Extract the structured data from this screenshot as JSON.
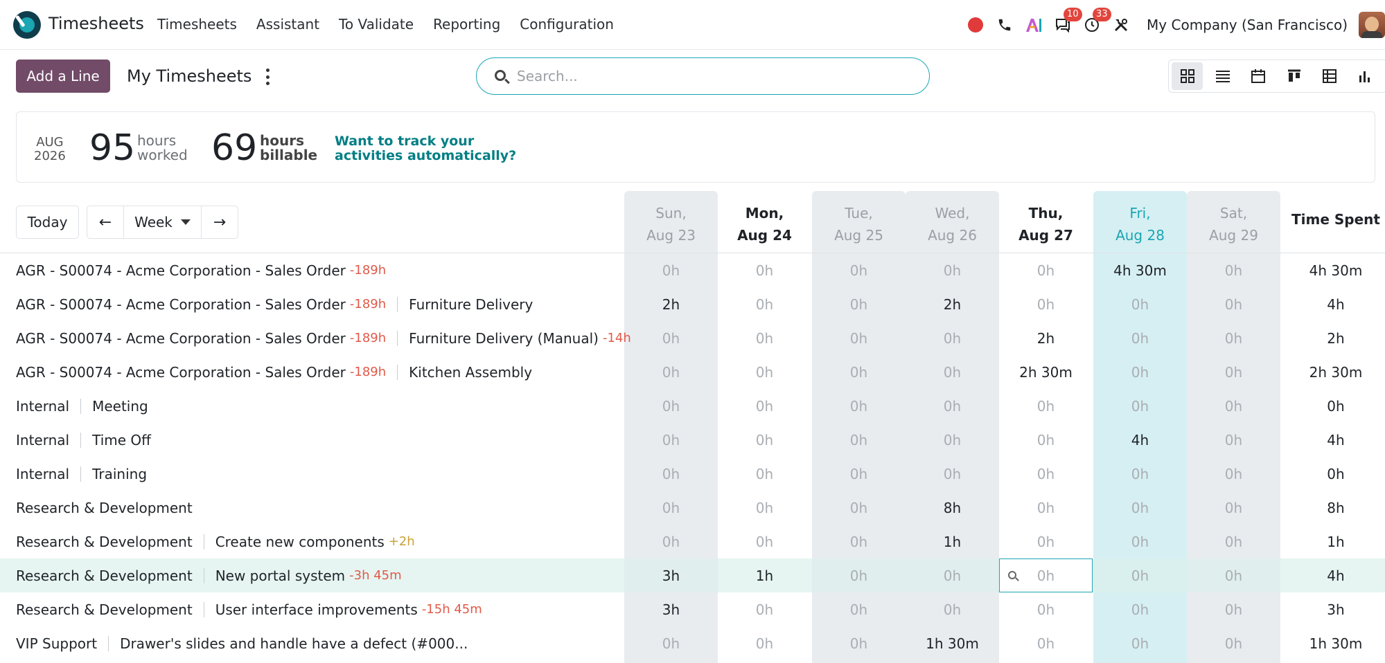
{
  "app": {
    "title": "Timesheets",
    "menu": [
      "Timesheets",
      "Assistant",
      "To Validate",
      "Reporting",
      "Configuration"
    ],
    "company": "My Company (San Francisco)",
    "badges": {
      "messages": "10",
      "activities": "33"
    },
    "icons": [
      "record-dot-icon",
      "phone-icon",
      "ai-icon",
      "chat-icon",
      "clock-icon",
      "tools-icon"
    ]
  },
  "control": {
    "add_label": "Add a Line",
    "page_title": "My Timesheets",
    "search_placeholder": "Search...",
    "views": [
      "grid-view-icon",
      "list-view-icon",
      "calendar-view-icon",
      "kanban-view-icon",
      "pivot-view-icon",
      "graph-view-icon"
    ],
    "active_view": "grid-view-icon"
  },
  "stats": {
    "month": "AUG",
    "year": "2026",
    "worked_value": "95",
    "worked_label_1": "hours",
    "worked_label_2": "worked",
    "billable_value": "69",
    "billable_label_1": "hours",
    "billable_label_2": "billable",
    "link_line_1": "Want to track your",
    "link_line_2": "activities automatically?"
  },
  "nav": {
    "today": "Today",
    "range": "Week",
    "prev": "←",
    "next": "→"
  },
  "colors": {
    "primary": "#714b67",
    "accent": "#1aa6b3",
    "negative": "#e05a4a",
    "positive": "#c9a23a"
  },
  "grid": {
    "days": [
      {
        "dow": "Sun,",
        "date": "Aug 23",
        "kind": "weekend"
      },
      {
        "dow": "Mon,",
        "date": "Aug 24",
        "kind": "normal"
      },
      {
        "dow": "Tue,",
        "date": "Aug 25",
        "kind": "weekend"
      },
      {
        "dow": "Wed,",
        "date": "Aug 26",
        "kind": "weekend"
      },
      {
        "dow": "Thu,",
        "date": "Aug 27",
        "kind": "normal"
      },
      {
        "dow": "Fri,",
        "date": "Aug 28",
        "kind": "today"
      },
      {
        "dow": "Sat,",
        "date": "Aug 29",
        "kind": "weekend"
      }
    ],
    "total_label": "Time Spent",
    "rows": [
      {
        "project": "AGR - S00074 - Acme Corporation - Sales Order",
        "project_delta": "-189h",
        "task": "",
        "task_delta": "",
        "task_delta_kind": "",
        "cells": [
          "0h",
          "0h",
          "0h",
          "0h",
          "0h",
          "4h 30m",
          "0h"
        ],
        "total": "4h 30m"
      },
      {
        "project": "AGR - S00074 - Acme Corporation - Sales Order",
        "project_delta": "-189h",
        "task": "Furniture Delivery",
        "task_delta": "",
        "task_delta_kind": "",
        "cells": [
          "2h",
          "0h",
          "0h",
          "2h",
          "0h",
          "0h",
          "0h"
        ],
        "total": "4h"
      },
      {
        "project": "AGR - S00074 - Acme Corporation - Sales Order",
        "project_delta": "-189h",
        "task": "Furniture Delivery (Manual)",
        "task_delta": "-14h",
        "task_delta_kind": "neg",
        "cells": [
          "0h",
          "0h",
          "0h",
          "0h",
          "2h",
          "0h",
          "0h"
        ],
        "total": "2h"
      },
      {
        "project": "AGR - S00074 - Acme Corporation - Sales Order",
        "project_delta": "-189h",
        "task": "Kitchen Assembly",
        "task_delta": "",
        "task_delta_kind": "",
        "cells": [
          "0h",
          "0h",
          "0h",
          "0h",
          "2h 30m",
          "0h",
          "0h"
        ],
        "total": "2h 30m"
      },
      {
        "project": "Internal",
        "project_delta": "",
        "task": "Meeting",
        "task_delta": "",
        "task_delta_kind": "",
        "cells": [
          "0h",
          "0h",
          "0h",
          "0h",
          "0h",
          "0h",
          "0h"
        ],
        "total": "0h"
      },
      {
        "project": "Internal",
        "project_delta": "",
        "task": "Time Off",
        "task_delta": "",
        "task_delta_kind": "",
        "cells": [
          "0h",
          "0h",
          "0h",
          "0h",
          "0h",
          "4h",
          "0h"
        ],
        "total": "4h"
      },
      {
        "project": "Internal",
        "project_delta": "",
        "task": "Training",
        "task_delta": "",
        "task_delta_kind": "",
        "cells": [
          "0h",
          "0h",
          "0h",
          "0h",
          "0h",
          "0h",
          "0h"
        ],
        "total": "0h"
      },
      {
        "project": "Research & Development",
        "project_delta": "",
        "task": "",
        "task_delta": "",
        "task_delta_kind": "",
        "cells": [
          "0h",
          "0h",
          "0h",
          "8h",
          "0h",
          "0h",
          "0h"
        ],
        "total": "8h"
      },
      {
        "project": "Research & Development",
        "project_delta": "",
        "task": "Create new components",
        "task_delta": "+2h",
        "task_delta_kind": "pos",
        "cells": [
          "0h",
          "0h",
          "0h",
          "1h",
          "0h",
          "0h",
          "0h"
        ],
        "total": "1h"
      },
      {
        "project": "Research & Development",
        "project_delta": "",
        "task": "New portal system",
        "task_delta": "-3h 45m",
        "task_delta_kind": "neg",
        "cells": [
          "3h",
          "1h",
          "0h",
          "0h",
          "0h",
          "0h",
          "0h"
        ],
        "total": "4h",
        "hover": true,
        "focus_cell": 4
      },
      {
        "project": "Research & Development",
        "project_delta": "",
        "task": "User interface improvements",
        "task_delta": "-15h 45m",
        "task_delta_kind": "neg",
        "cells": [
          "3h",
          "0h",
          "0h",
          "0h",
          "0h",
          "0h",
          "0h"
        ],
        "total": "3h"
      },
      {
        "project": "VIP Support",
        "project_delta": "",
        "task": "Drawer's slides and handle have a defect (#000...",
        "task_delta": "",
        "task_delta_kind": "",
        "cells": [
          "0h",
          "0h",
          "0h",
          "1h 30m",
          "0h",
          "0h",
          "0h"
        ],
        "total": "1h 30m"
      }
    ]
  }
}
